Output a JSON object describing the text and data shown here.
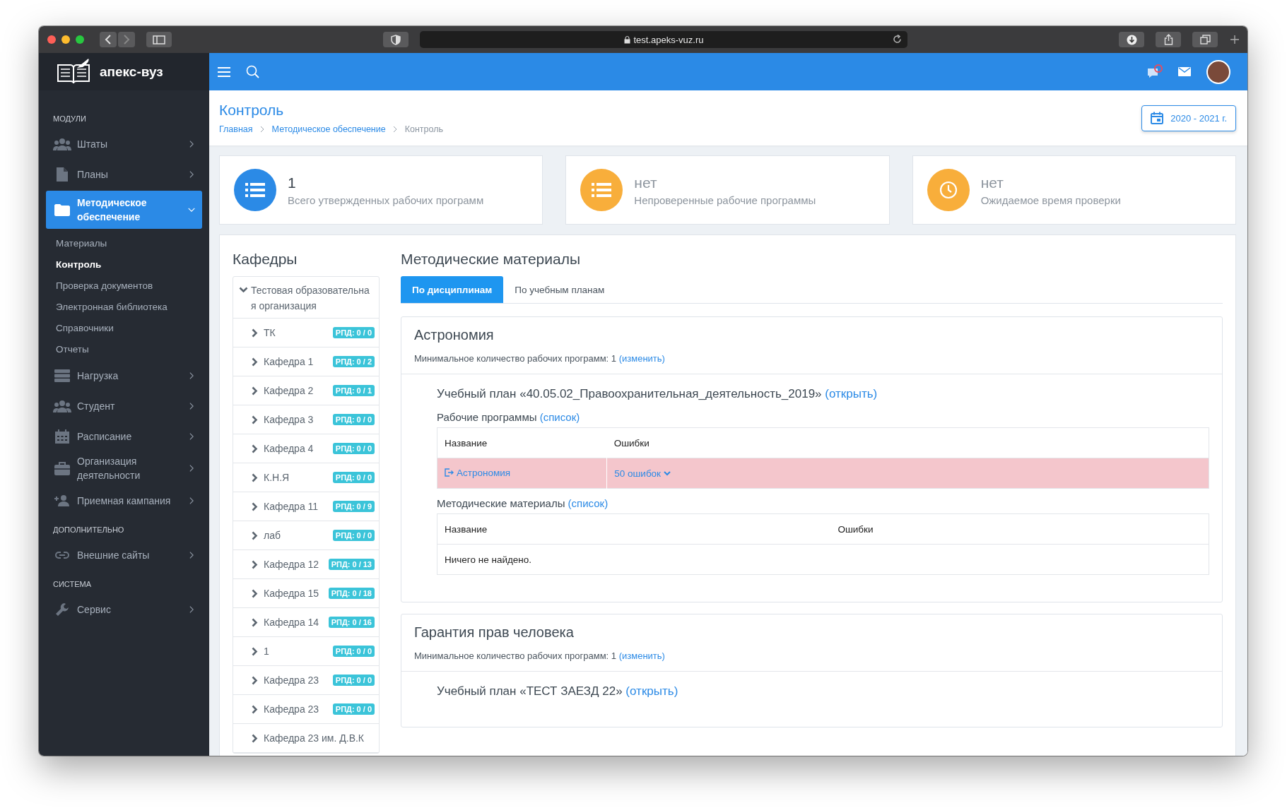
{
  "browser": {
    "url": "test.apeks-vuz.ru"
  },
  "app": {
    "logo_text": "апекс-вуз"
  },
  "sidebar": {
    "sections": [
      {
        "heading": "МОДУЛИ",
        "items": [
          {
            "label": "Штаты",
            "expanded": false
          },
          {
            "label": "Планы",
            "expanded": false
          },
          {
            "label": "Методическое обеспечение",
            "expanded": true,
            "children": [
              {
                "label": "Материалы",
                "selected": false
              },
              {
                "label": "Контроль",
                "selected": true
              },
              {
                "label": "Проверка документов",
                "selected": false
              },
              {
                "label": "Электронная библиотека",
                "selected": false
              },
              {
                "label": "Справочники",
                "selected": false
              },
              {
                "label": "Отчеты",
                "selected": false
              }
            ]
          },
          {
            "label": "Нагрузка",
            "expanded": false
          },
          {
            "label": "Студент",
            "expanded": false
          },
          {
            "label": "Расписание",
            "expanded": false
          },
          {
            "label": "Организация деятельности",
            "expanded": false
          },
          {
            "label": "Приемная кампания",
            "expanded": false
          }
        ]
      },
      {
        "heading": "ДОПОЛНИТЕЛЬНО",
        "items": [
          {
            "label": "Внешние сайты",
            "expanded": false
          }
        ]
      },
      {
        "heading": "СИСТЕМА",
        "items": [
          {
            "label": "Сервис",
            "expanded": false
          }
        ]
      }
    ]
  },
  "page": {
    "title": "Контроль",
    "breadcrumbs": [
      "Главная",
      "Методическое обеспечение",
      "Контроль"
    ],
    "year_button": "2020 - 2021 г."
  },
  "stats": [
    {
      "value": "1",
      "label": "Всего утвержденных рабочих программ",
      "color": "#2b8ae6"
    },
    {
      "value": "нет",
      "label": "Непроверенные рабочие программы",
      "color": "#f8ae3b"
    },
    {
      "value": "нет",
      "label": "Ожидаемое время проверки",
      "color": "#f8ae3b"
    }
  ],
  "departments": {
    "title": "Кафедры",
    "tree": {
      "label": "Тестовая образовательная организация",
      "expanded": true,
      "children": [
        {
          "label": "ТК",
          "badge": "РПД: 0 / 0",
          "expanded": false
        },
        {
          "label": "Кафедра 1",
          "badge": "РПД: 0 / 2",
          "expanded": false
        },
        {
          "label": "Кафедра 2",
          "badge": "РПД: 0 / 1",
          "expanded": false
        },
        {
          "label": "Кафедра 3",
          "badge": "РПД: 0 / 0",
          "expanded": false
        },
        {
          "label": "Кафедра 4",
          "badge": "РПД: 0 / 0",
          "expanded": false
        },
        {
          "label": "К.Н.Я",
          "badge": "РПД: 0 / 0",
          "expanded": false
        },
        {
          "label": "Кафедра 11",
          "badge": "РПД: 0 / 9",
          "expanded": false
        },
        {
          "label": "лаб",
          "badge": "РПД: 0 / 0",
          "expanded": false
        },
        {
          "label": "Кафедра 12",
          "badge": "РПД: 0 / 13",
          "expanded": false
        },
        {
          "label": "Кафедра 15",
          "badge": "РПД: 0 / 18",
          "expanded": false
        },
        {
          "label": "Кафедра 14",
          "badge": "РПД: 0 / 16",
          "expanded": false
        },
        {
          "label": "1",
          "badge": "РПД: 0 / 0",
          "expanded": false
        },
        {
          "label": "Кафедра 23",
          "badge": "РПД: 0 / 0",
          "expanded": false
        },
        {
          "label": "Кафедра 23",
          "badge": "РПД: 0 / 0",
          "expanded": false
        },
        {
          "label": "Кафедра 23 им. Д.В.К",
          "expanded": false
        }
      ]
    }
  },
  "materials": {
    "title": "Методические материалы",
    "tabs": [
      {
        "label": "По дисциплинам",
        "selected": true
      },
      {
        "label": "По учебным планам",
        "selected": false
      }
    ],
    "disciplines": [
      {
        "title": "Астрономия",
        "min_text": "Минимальное количество рабочих программ: 1",
        "change_link": "(изменить)",
        "plans": [
          {
            "title": "Учебный план «40.05.02_Правоохранительная_деятельность_2019»",
            "open_link": "(открыть)",
            "tables": [
              {
                "kind": "programs",
                "heading": "Рабочие программы",
                "link": "(список)",
                "columns": [
                  "Название",
                  "Ошибки"
                ],
                "rows": [
                  {
                    "name": "Астрономия",
                    "errors": "50 ошибок",
                    "has_errors": true
                  }
                ]
              },
              {
                "kind": "materials",
                "heading": "Методические материалы",
                "link": "(список)",
                "columns": [
                  "Название",
                  "Ошибки"
                ],
                "empty": "Ничего не найдено."
              }
            ]
          }
        ]
      },
      {
        "title": "Гарантия прав человека",
        "min_text": "Минимальное количество рабочих программ: 1",
        "change_link": "(изменить)",
        "plans": [
          {
            "title": "Учебный план «ТЕСТ ЗАЕЗД 22»",
            "open_link": "(открыть)"
          }
        ]
      }
    ]
  }
}
